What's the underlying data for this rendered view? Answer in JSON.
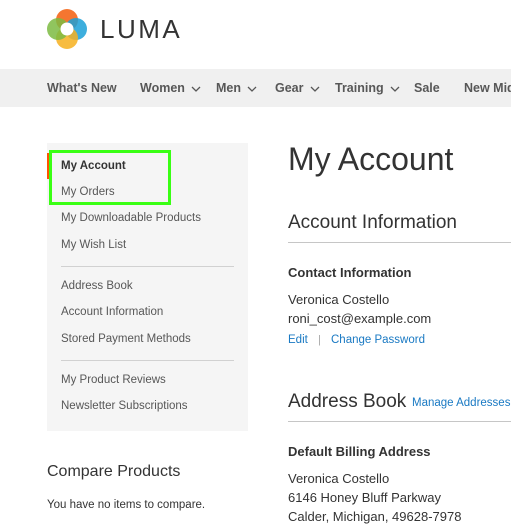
{
  "header": {
    "logo_text": "LUMA"
  },
  "nav": {
    "items": [
      {
        "label": "What's New",
        "has_dropdown": false
      },
      {
        "label": "Women",
        "has_dropdown": true
      },
      {
        "label": "Men",
        "has_dropdown": true
      },
      {
        "label": "Gear",
        "has_dropdown": true
      },
      {
        "label": "Training",
        "has_dropdown": true
      },
      {
        "label": "Sale",
        "has_dropdown": false
      },
      {
        "label": "New Mid",
        "has_dropdown": false
      }
    ]
  },
  "sidebar": {
    "items": [
      {
        "label": "My Account",
        "current": true
      },
      {
        "label": "My Orders"
      },
      {
        "label": "My Downloadable Products"
      },
      {
        "label": "My Wish List"
      },
      {
        "label": "Address Book"
      },
      {
        "label": "Account Information"
      },
      {
        "label": "Stored Payment Methods"
      },
      {
        "label": "My Product Reviews"
      },
      {
        "label": "Newsletter Subscriptions"
      }
    ],
    "accent_color": "#ff5501",
    "highlight_color": "#39ff14"
  },
  "compare": {
    "title": "Compare Products",
    "empty_text": "You have no items to compare."
  },
  "main": {
    "page_title": "My Account",
    "account_info": {
      "title": "Account Information",
      "contact_title": "Contact Information",
      "name": "Veronica Costello",
      "email": "roni_cost@example.com",
      "edit_label": "Edit",
      "separator": "|",
      "change_password_label": "Change Password"
    },
    "address_book": {
      "title": "Address Book",
      "manage_label": "Manage Addresses",
      "billing_title": "Default Billing Address",
      "billing_lines": [
        "Veronica Costello",
        "6146 Honey Bluff Parkway",
        "Calder, Michigan, 49628-7978"
      ]
    },
    "link_color": "#1979c3"
  }
}
